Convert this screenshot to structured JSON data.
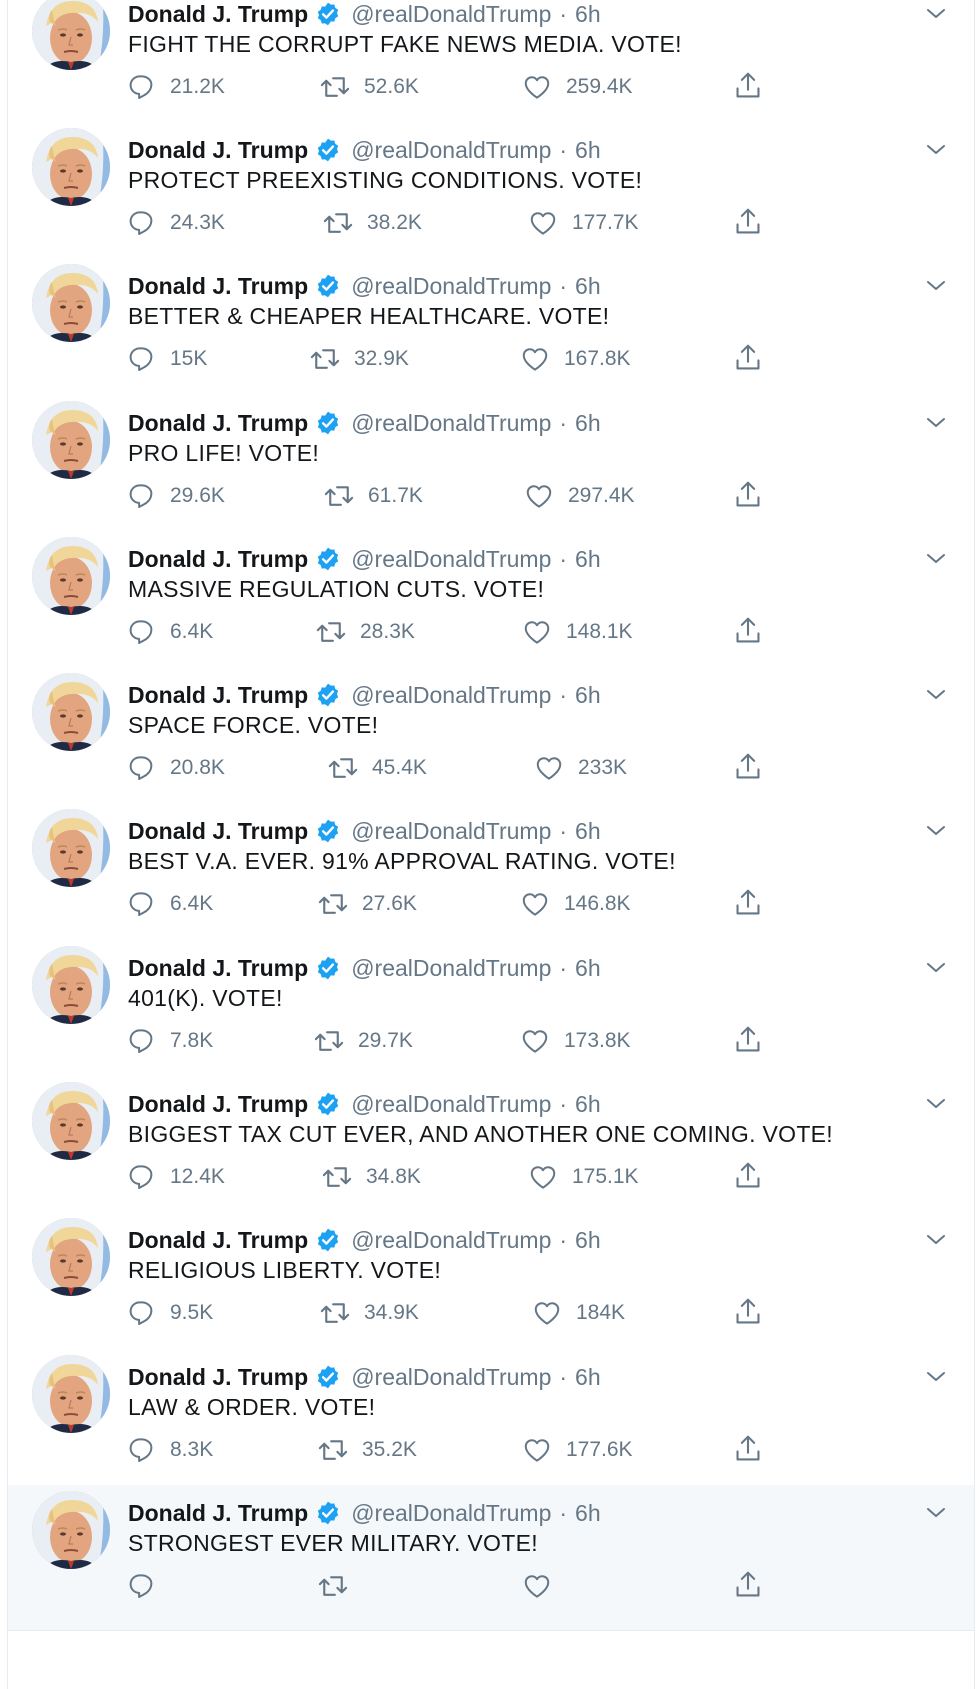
{
  "accent": "#1da1f2",
  "muted": "#657786",
  "author": {
    "name": "Donald J. Trump",
    "handle": "@realDonaldTrump",
    "time": "6h",
    "separator": "·"
  },
  "icons": {
    "verified": "verified-badge-icon",
    "caret": "chevron-down-icon",
    "reply": "reply-icon",
    "retweet": "retweet-icon",
    "like": "heart-icon",
    "share": "share-icon"
  },
  "tweets": [
    {
      "text": "FIGHT THE CORRUPT FAKE NEWS MEDIA. VOTE!",
      "replies": "21.2K",
      "retweets": "52.6K",
      "likes": "259.4K"
    },
    {
      "text": "PROTECT PREEXISTING CONDITIONS. VOTE!",
      "replies": "24.3K",
      "retweets": "38.2K",
      "likes": "177.7K"
    },
    {
      "text": "BETTER & CHEAPER HEALTHCARE. VOTE!",
      "replies": "15K",
      "retweets": "32.9K",
      "likes": "167.8K"
    },
    {
      "text": "PRO LIFE! VOTE!",
      "replies": "29.6K",
      "retweets": "61.7K",
      "likes": "297.4K"
    },
    {
      "text": "MASSIVE REGULATION CUTS. VOTE!",
      "replies": "6.4K",
      "retweets": "28.3K",
      "likes": "148.1K"
    },
    {
      "text": "SPACE FORCE. VOTE!",
      "replies": "20.8K",
      "retweets": "45.4K",
      "likes": "233K"
    },
    {
      "text": "BEST V.A. EVER. 91% APPROVAL RATING. VOTE!",
      "replies": "6.4K",
      "retweets": "27.6K",
      "likes": "146.8K"
    },
    {
      "text": "401(K). VOTE!",
      "replies": "7.8K",
      "retweets": "29.7K",
      "likes": "173.8K"
    },
    {
      "text": "BIGGEST TAX CUT EVER, AND ANOTHER ONE COMING. VOTE!",
      "replies": "12.4K",
      "retweets": "34.8K",
      "likes": "175.1K"
    },
    {
      "text": "RELIGIOUS LIBERTY. VOTE!",
      "replies": "9.5K",
      "retweets": "34.9K",
      "likes": "184K"
    },
    {
      "text": "LAW & ORDER. VOTE!",
      "replies": "8.3K",
      "retweets": "35.2K",
      "likes": "177.6K"
    },
    {
      "text": "STRONGEST EVER MILITARY. VOTE!",
      "replies": "",
      "retweets": "",
      "likes": ""
    }
  ]
}
